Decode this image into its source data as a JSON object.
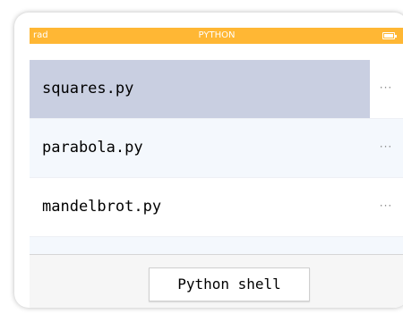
{
  "statusbar": {
    "mode": "rad",
    "title": "PYTHON",
    "battery_icon": "battery-full-icon",
    "color": "#ffb734"
  },
  "scripts": [
    {
      "name": "squares.py",
      "options": "···",
      "selected": true
    },
    {
      "name": "parabola.py",
      "options": "···",
      "selected": false
    },
    {
      "name": "mandelbrot.py",
      "options": "···",
      "selected": false
    }
  ],
  "footer": {
    "shell_button_label": "Python shell"
  },
  "colors": {
    "selected_row": "#c9cfe1",
    "alt_row": "#f4f8fd",
    "footer_bg": "#f6f6f6"
  }
}
